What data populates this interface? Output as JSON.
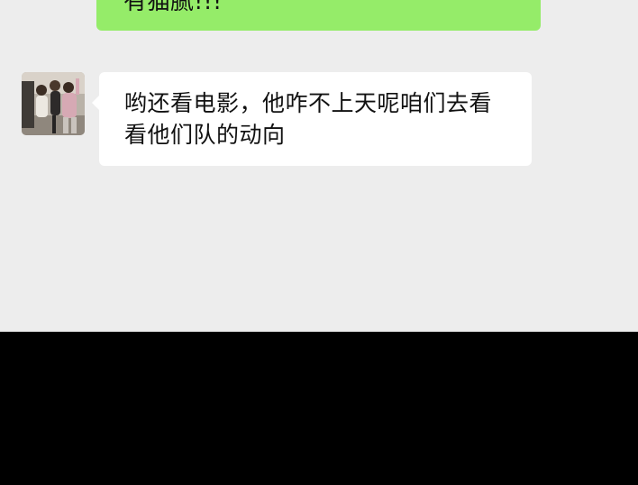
{
  "chat": {
    "outgoing_message": "有猫腻!!!",
    "incoming_message": "哟还看电影，他咋不上天呢咱们去看看他们队的动向"
  },
  "colors": {
    "chat_background": "#ededed",
    "outgoing_bubble": "#95ec69",
    "incoming_bubble": "#ffffff",
    "bottom_region": "#000000"
  },
  "icons": {
    "avatar": "contact-avatar-photo"
  }
}
